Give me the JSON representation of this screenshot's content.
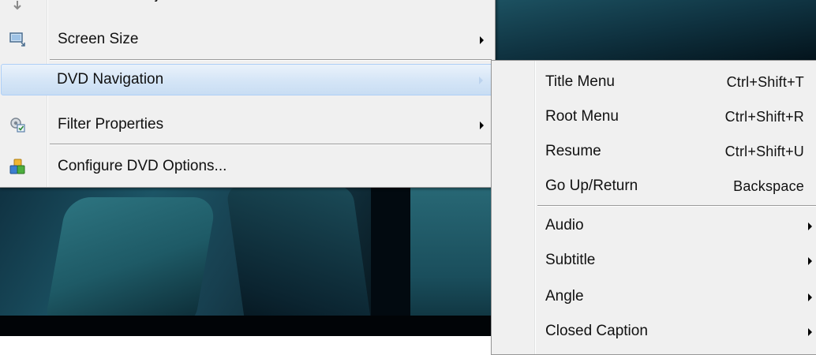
{
  "main_menu": {
    "items": [
      {
        "label": "Full Screen Adjust",
        "icon": "fullscreen-adjust-icon",
        "submenu": false
      },
      {
        "label": "Screen Size",
        "icon": "monitor-icon",
        "submenu": true
      },
      {
        "label": "DVD Navigation",
        "icon": "",
        "submenu": true,
        "highlighted": true
      },
      {
        "label": "Filter Properties",
        "icon": "filter-gear-icon",
        "submenu": true
      },
      {
        "label": "Configure DVD Options...",
        "icon": "dvd-options-icon",
        "submenu": false
      }
    ]
  },
  "dvd_navigation_submenu": {
    "items": [
      {
        "label": "Title Menu",
        "shortcut": "Ctrl+Shift+T"
      },
      {
        "label": "Root Menu",
        "shortcut": "Ctrl+Shift+R"
      },
      {
        "label": "Resume",
        "shortcut": "Ctrl+Shift+U"
      },
      {
        "label": "Go Up/Return",
        "shortcut": "Backspace"
      },
      {
        "label": "Audio",
        "submenu": true
      },
      {
        "label": "Subtitle",
        "submenu": true
      },
      {
        "label": "Angle",
        "submenu": true
      },
      {
        "label": "Closed Caption",
        "submenu": true
      }
    ]
  },
  "colors": {
    "menu_bg": "#f0f0f0",
    "menu_border": "#979797",
    "highlight": "#d6e6f7",
    "video_dark": "#020a10",
    "video_teal": "#1c5566"
  }
}
